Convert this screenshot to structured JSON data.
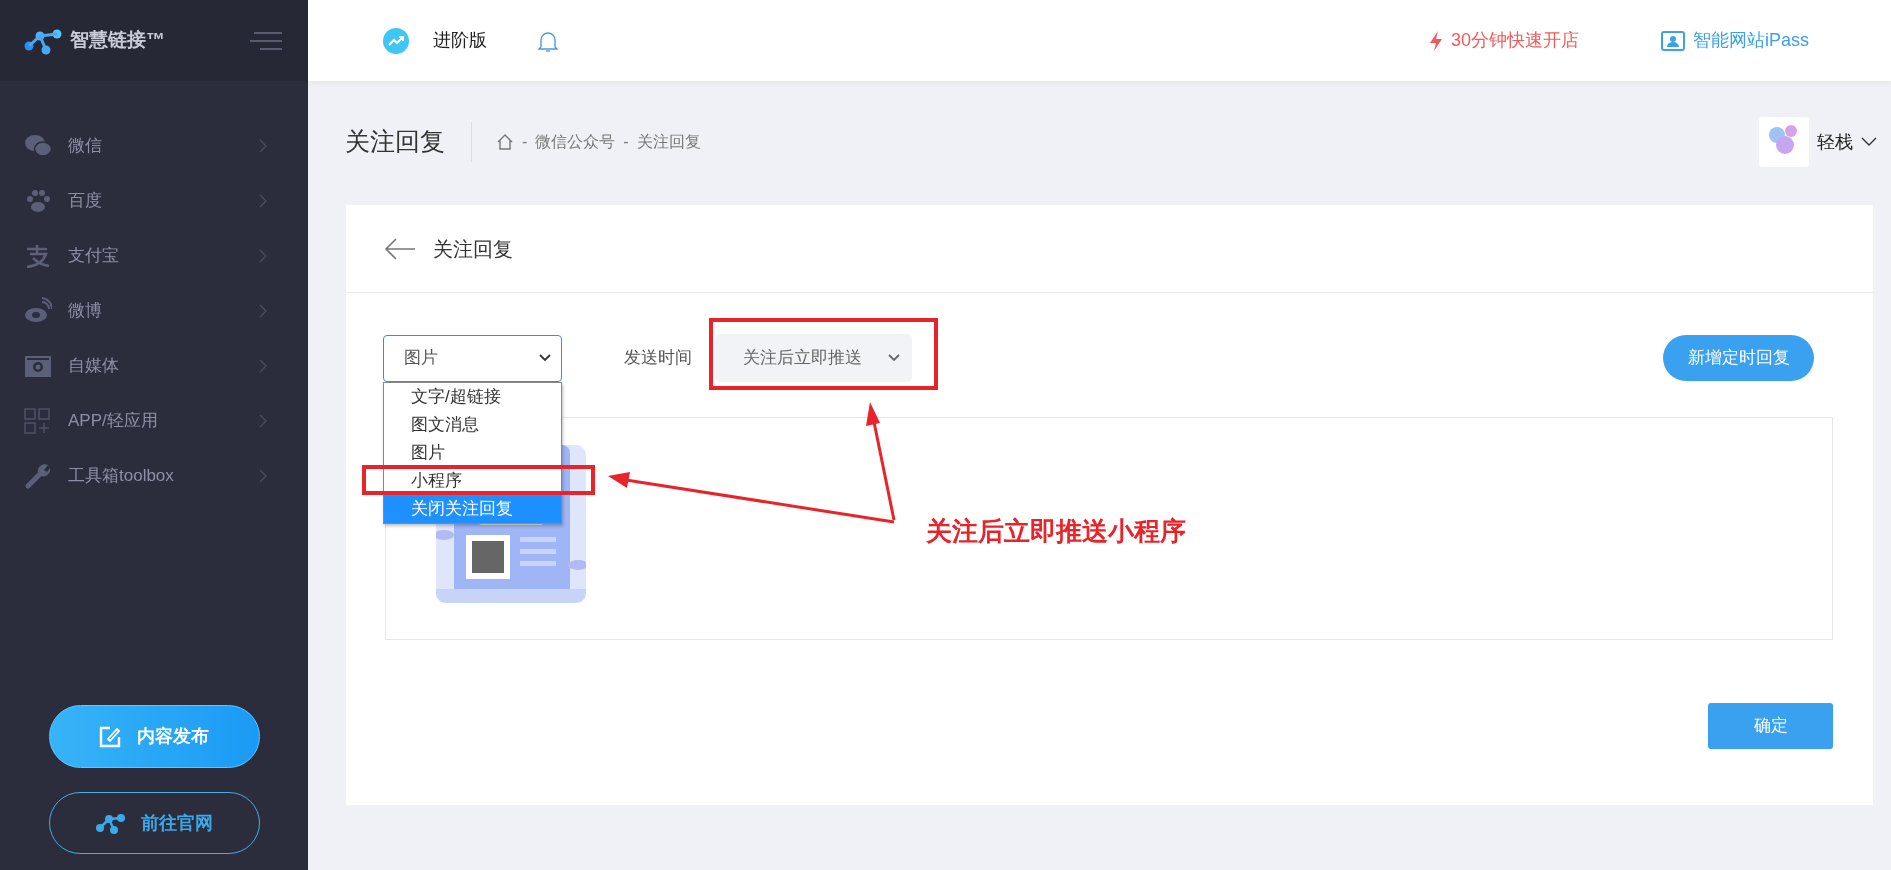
{
  "sidebar": {
    "brand": "智慧链接™",
    "items": [
      {
        "label": "微信",
        "kind": "wechat"
      },
      {
        "label": "百度",
        "kind": "paw"
      },
      {
        "label": "支付宝",
        "kind": "alipay"
      },
      {
        "label": "微博",
        "kind": "weibo"
      },
      {
        "label": "自媒体",
        "kind": "camera"
      },
      {
        "label": "APP/轻应用",
        "kind": "grid"
      },
      {
        "label": "工具箱toolbox",
        "kind": "wrench"
      }
    ],
    "buttons": [
      {
        "label": "内容发布",
        "kind": "primary"
      },
      {
        "label": "前往官网",
        "kind": "outline"
      }
    ]
  },
  "header": {
    "edition": "进阶版",
    "links": [
      {
        "label": "30分钟快速开店",
        "kind": "bolt"
      },
      {
        "label": "智能网站iPass",
        "kind": "portrait"
      }
    ]
  },
  "page": {
    "title": "关注回复",
    "breadcrumb": [
      {
        "separator": "-",
        "label": "微信公众号"
      },
      {
        "separator": "-",
        "label": "关注回复"
      }
    ],
    "user": "轻栈"
  },
  "card": {
    "title": "关注回复",
    "type_select": {
      "value": "图片",
      "expanded": true,
      "options": [
        {
          "label": "文字/超链接",
          "highlighted": false
        },
        {
          "label": "图文消息",
          "highlighted": false
        },
        {
          "label": "图片",
          "highlighted": false
        },
        {
          "label": "小程序",
          "highlighted": false
        },
        {
          "label": "关闭关注回复",
          "highlighted": true
        }
      ]
    },
    "send_time": {
      "label": "发送时间",
      "value": "关注后立即推送"
    },
    "add_button": "新增定时回复",
    "confirm_button": "确定"
  },
  "callout": {
    "text": "关注后立即推送小程序"
  }
}
